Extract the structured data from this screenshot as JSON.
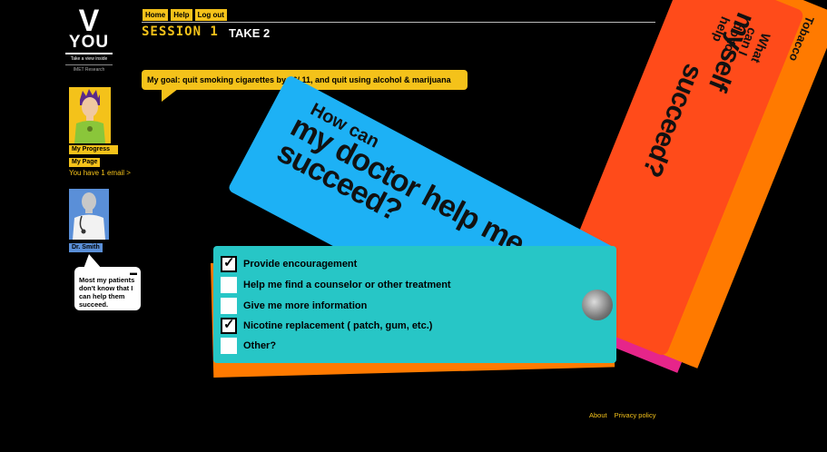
{
  "logo": {
    "letter": "V",
    "word": "YOU",
    "tagline": "Take a view inside",
    "sub": "IMET Research"
  },
  "sidebar": {
    "progress_label": "My Progress",
    "page_label": "My Page",
    "email_text": "You have 1 email >",
    "doctor_label": "Dr. Smith",
    "doctor_message": "Most my patients don't  know that I can help them succeed."
  },
  "nav": {
    "home": "Home",
    "help": "Help",
    "logout": "Log out"
  },
  "session": {
    "label": "SESSION 1",
    "take": "TAKE 2"
  },
  "goal": {
    "text": "My goal: quit smoking cigarettes by 06/     11, and quit using alcohol & marijuana"
  },
  "cards": {
    "blue_small": "How can",
    "blue_large_1": "my doctor help me",
    "blue_large_2": "succeed?",
    "red_small": "What can I do to help",
    "red_large_1": "myself",
    "red_large_2": "succeed?",
    "tobacco": "Tobacco"
  },
  "checklist": [
    {
      "label": "Provide encouragement",
      "checked": true
    },
    {
      "label": "Help me find a counselor or other treatment",
      "checked": false
    },
    {
      "label": "Give me more information",
      "checked": false
    },
    {
      "label": "Nicotine replacement ( patch, gum, etc.)",
      "checked": true
    },
    {
      "label": "Other?",
      "checked": false
    }
  ],
  "footer": {
    "about": "About",
    "privacy": "Privacy policy"
  },
  "colors": {
    "accent": "#f4c21a",
    "teal": "#27c6c6",
    "blue": "#1db1f5",
    "red": "#ff4b1a",
    "orange": "#ff7a00",
    "pink": "#e6258a"
  }
}
